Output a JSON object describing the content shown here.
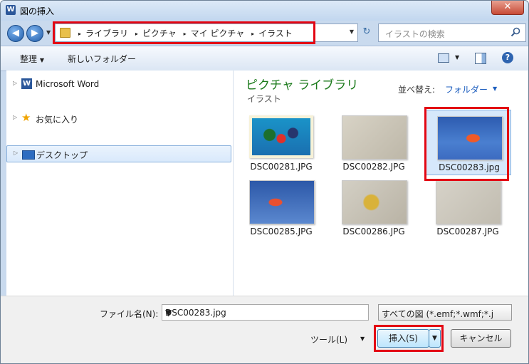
{
  "window": {
    "title": "図の挿入",
    "app_icon_letter": "W",
    "close_glyph": "✕"
  },
  "nav": {
    "back_glyph": "◀",
    "forward_glyph": "▶",
    "recent_glyph": "▼",
    "refresh_glyph": "↻",
    "dropdown_glyph": "▼"
  },
  "address": {
    "separator": "▸",
    "crumbs": [
      "ライブラリ",
      "ピクチャ",
      "マイ ピクチャ",
      "イラスト"
    ]
  },
  "search": {
    "placeholder": "イラストの検索"
  },
  "toolbar": {
    "organize_label": "整理",
    "organize_dd": "▼",
    "new_folder_label": "新しいフォルダー",
    "view_dd": "▼",
    "help_glyph": "?"
  },
  "navpane": {
    "expand_glyph": "▷",
    "items": [
      {
        "label": "Microsoft Word",
        "icon": "word-icon"
      },
      {
        "label": "お気に入り",
        "icon": "star-icon",
        "glyph": "★"
      },
      {
        "label": "デスクトップ",
        "icon": "desktop-icon",
        "selected": true
      }
    ]
  },
  "library": {
    "title": "ピクチャ ライブラリ",
    "subtitle": "イラスト",
    "arrange_label": "並べ替え:",
    "arrange_value": "フォルダー",
    "arrange_dd": "▼"
  },
  "files": [
    {
      "name": "DSC00281.JPG"
    },
    {
      "name": "DSC00282.JPG"
    },
    {
      "name": "DSC00283.jpg",
      "selected": true
    },
    {
      "name": "DSC00285.JPG"
    },
    {
      "name": "DSC00286.JPG"
    },
    {
      "name": "DSC00287.JPG"
    }
  ],
  "footer": {
    "filename_label": "ファイル名(N):",
    "filename_value": "DSC00283.jpg",
    "filename_dd": "▼",
    "filetype_value": "すべての図 (*.emf;*.wmf;*.j",
    "tools_label": "ツール(L)",
    "tools_dd": "▼",
    "insert_label": "挿入(S)",
    "insert_dd": "▼",
    "cancel_label": "キャンセル"
  },
  "colors": {
    "highlight": "#e30613",
    "library_title": "#1b7a1b",
    "link": "#1e5fbf"
  }
}
